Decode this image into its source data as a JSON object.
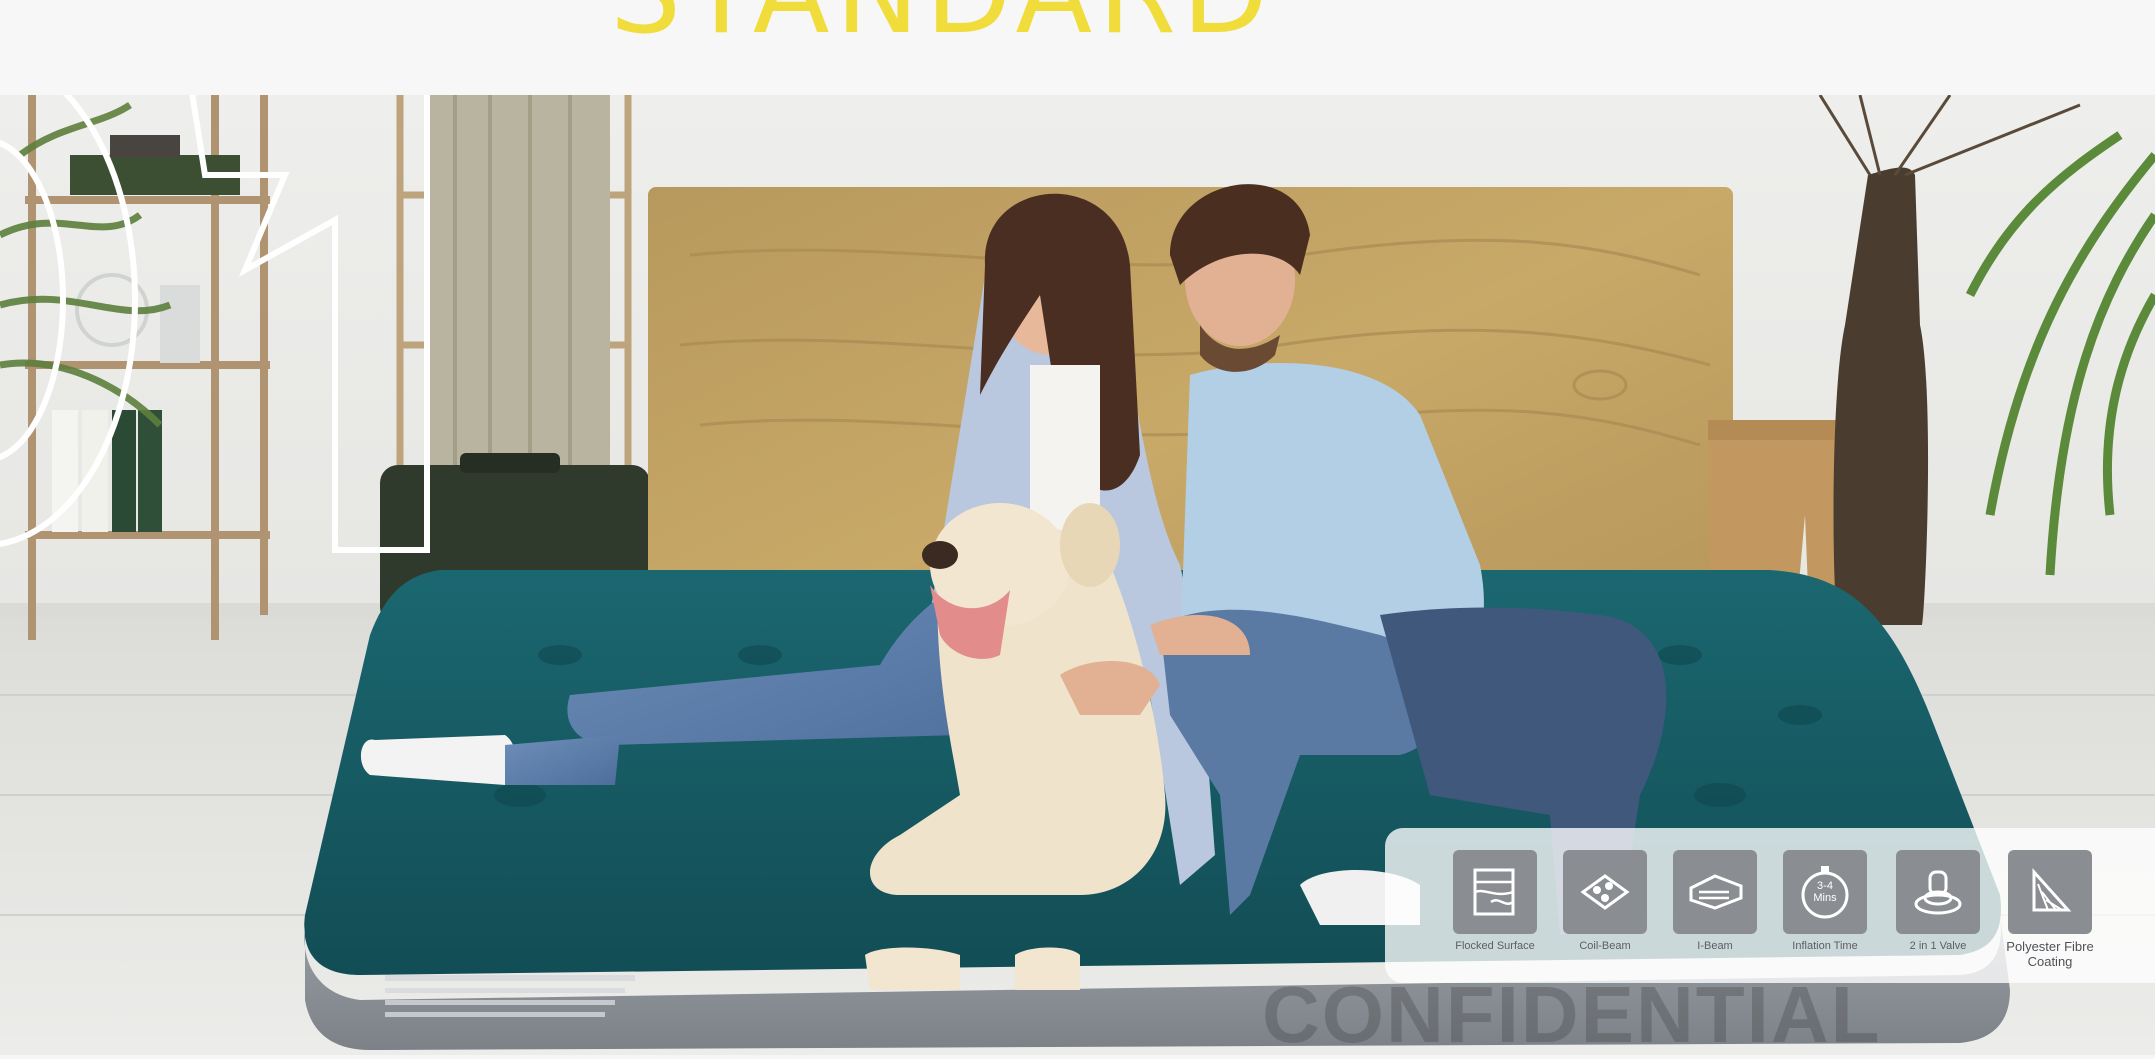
{
  "header": {
    "headline": "STANDARD"
  },
  "badges": [
    {
      "label": "Flocked Surface",
      "icon": "flocked-surface-icon"
    },
    {
      "label": "Coil-Beam",
      "icon": "coil-beam-icon"
    },
    {
      "label": "I-Beam",
      "icon": "i-beam-icon"
    },
    {
      "label": "Inflation Time",
      "icon": "stopwatch-icon",
      "icon_text": "3-4 Mins"
    },
    {
      "label": "2 in 1 Valve",
      "icon": "valve-icon"
    },
    {
      "label": "Polyester Fibre Coating",
      "icon": "fibre-coating-icon"
    }
  ],
  "watermark": "CONFIDENTIAL",
  "colors": {
    "headline": "#f0dc3a",
    "mattress_top": "#15575f",
    "mattress_side": "#8e939a",
    "badge_tile": "#8a8d91"
  }
}
